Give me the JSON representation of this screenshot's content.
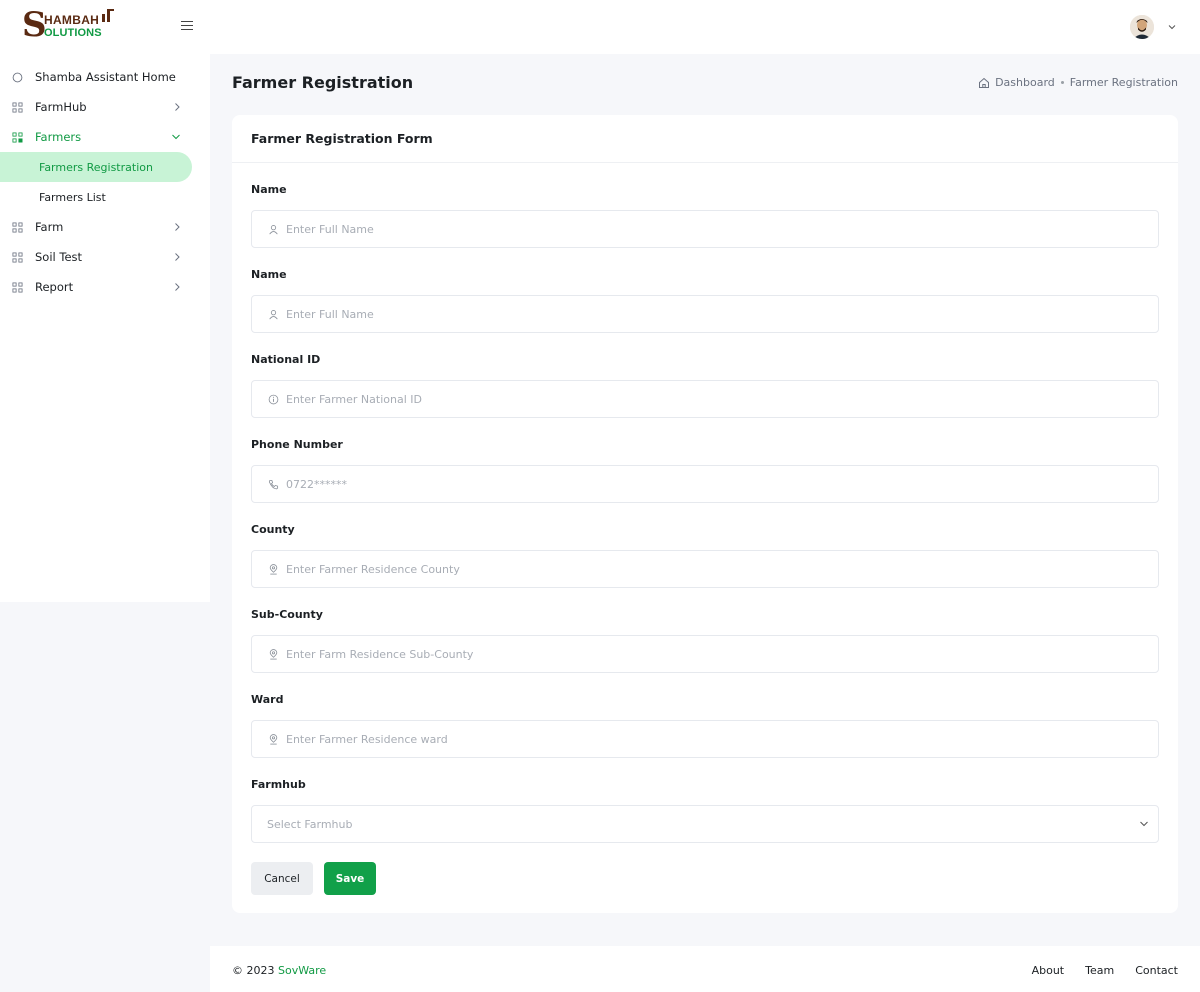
{
  "brand": {
    "logo_letter": "S",
    "logo_line1": "HAMBAH",
    "logo_line2": "OLUTIONS",
    "primary_color": "#119a44",
    "secondary_color": "#5a2a12"
  },
  "sidebar": {
    "items": [
      {
        "label": "Shamba Assistant Home",
        "icon": "circle-icon"
      },
      {
        "label": "FarmHub",
        "icon": "grid-icon"
      },
      {
        "label": "Farmers",
        "icon": "grid-icon",
        "expanded": true
      },
      {
        "label": "Farm",
        "icon": "grid-icon"
      },
      {
        "label": "Soil Test",
        "icon": "grid-icon"
      },
      {
        "label": "Report",
        "icon": "grid-icon"
      }
    ],
    "farmers_subitems": [
      {
        "label": "Farmers Registration",
        "active": true
      },
      {
        "label": "Farmers List"
      }
    ]
  },
  "header": {
    "title": "Farmer Registration",
    "breadcrumb": {
      "home": "Dashboard",
      "current": "Farmer Registration"
    }
  },
  "form": {
    "title": "Farmer Registration Form",
    "fields": [
      {
        "label": "Name",
        "placeholder": "Enter Full Name",
        "icon": "user-icon"
      },
      {
        "label": "Name",
        "placeholder": "Enter Full Name",
        "icon": "user-icon"
      },
      {
        "label": "National ID",
        "placeholder": "Enter Farmer National ID",
        "icon": "info-icon"
      },
      {
        "label": "Phone Number",
        "placeholder": "0722******",
        "icon": "phone-icon"
      },
      {
        "label": "County",
        "placeholder": "Enter Farmer Residence County",
        "icon": "location-pin-icon"
      },
      {
        "label": "Sub-County",
        "placeholder": "Enter Farm Residence Sub-County",
        "icon": "location-pin-icon"
      },
      {
        "label": "Ward",
        "placeholder": "Enter Farmer Residence ward",
        "icon": "location-pin-icon"
      }
    ],
    "farmhub": {
      "label": "Farmhub",
      "placeholder": "Select Farmhub"
    },
    "cancel_label": "Cancel",
    "save_label": "Save"
  },
  "footer": {
    "copyright": "© 2023",
    "company": "SovWare",
    "links": [
      "About",
      "Team",
      "Contact"
    ]
  }
}
